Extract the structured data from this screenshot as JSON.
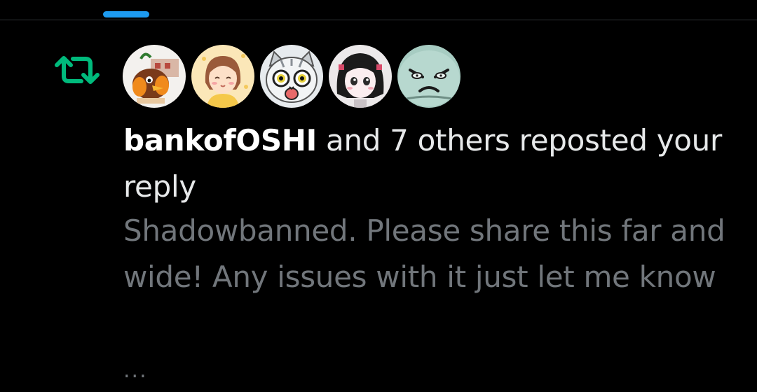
{
  "notification": {
    "type_icon": "repost-icon",
    "actor_name": "bankofOSHI",
    "action_text": " and 7 others reposted your reply",
    "post_preview": "Shadowbanned. Please share this far and wide! Any issues with it just let me know",
    "more_indicator": "...",
    "avatars": [
      {
        "icon": "bird-avatar"
      },
      {
        "icon": "girl-avatar"
      },
      {
        "icon": "cat-avatar"
      },
      {
        "icon": "doll-avatar"
      },
      {
        "icon": "frown-face-avatar"
      }
    ]
  },
  "colors": {
    "background": "#000000",
    "repost_green": "#00ba7c",
    "accent_blue": "#1d9bf0",
    "primary_text": "#e7e9ea",
    "secondary_text": "#71767b",
    "divider": "#2f3336"
  }
}
